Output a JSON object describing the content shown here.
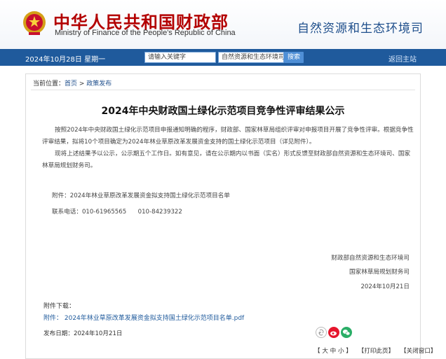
{
  "header": {
    "ministry_cn": "中华人民共和国财政部",
    "ministry_en": "Ministry of Finance of the People's Republic of China",
    "department": "自然资源和生态环境司"
  },
  "navbar": {
    "date": "2024年10月28日  星期一",
    "search_placeholder": "请输入关键字",
    "site_select": "自然资源和生态环境司",
    "search_button": "搜索",
    "home_link": "返回主站"
  },
  "breadcrumb": {
    "prefix": "当前位置：",
    "home": "首页",
    "separator": " > ",
    "section": "政策发布"
  },
  "article": {
    "title": "2024年中央财政国土绿化示范项目竞争性评审结果公示",
    "paragraph1": "按照2024年中央财政国土绿化示范项目申报通知明确的程序，财政部、国家林草局组织评审对申报项目开展了竞争性评审。根据竞争性评审结果，拟将10个项目确定为2024年林业草原改革发展资金支持的国土绿化示范项目（详见附件）。",
    "paragraph2": "现将上述结果予以公示，公示期五个工作日。如有意见，请在公示期内以书面（实名）形式反馈至财政部自然资源和生态环境司、国家林草局规划财务司。",
    "attachment_note": "附件：2024年林业草原改革发展资金拟支持国土绿化示范项目名单",
    "contact": "联系电话：010-61965565      010-84239322",
    "sign1": "财政部自然资源和生态环境司",
    "sign2": "国家林草局规划财务司",
    "sign_date": "2024年10月21日"
  },
  "attachments": {
    "label": "附件下载：",
    "file": "附件：  2024年林业草原改革发展资金拟支持国土绿化示范项目名单.pdf"
  },
  "publish": {
    "label": "发布日期：",
    "date": "2024年10月21日"
  },
  "footer": {
    "font_size": "【 大 中 小 】",
    "print": "【打印此页】",
    "close": "【关闭窗口】"
  },
  "colors": {
    "brand_red": "#b30000",
    "nav_blue": "#1f5a9c",
    "weibo": "#e6162d",
    "wechat": "#2aae67"
  }
}
